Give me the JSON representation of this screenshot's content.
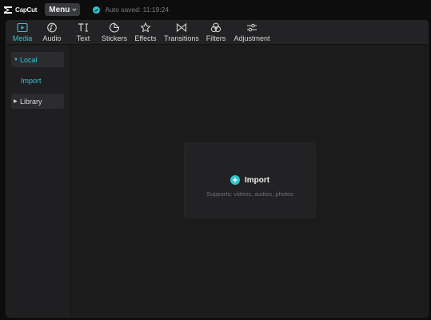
{
  "app": {
    "logo_text": "CapCut",
    "menu_label": "Menu",
    "save_status": "Auto saved: 11:19:24"
  },
  "toolbar": {
    "active": "Media",
    "items": [
      {
        "label": "Media",
        "icon": "media-icon"
      },
      {
        "label": "Audio",
        "icon": "audio-icon"
      },
      {
        "label": "Text",
        "icon": "text-icon"
      },
      {
        "label": "Stickers",
        "icon": "stickers-icon"
      },
      {
        "label": "Effects",
        "icon": "effects-icon"
      },
      {
        "label": "Transitions",
        "icon": "transitions-icon"
      },
      {
        "label": "Filters",
        "icon": "filters-icon"
      },
      {
        "label": "Adjustment",
        "icon": "adjustment-icon"
      }
    ]
  },
  "sidebar": {
    "local_label": "Local",
    "import_label": "Import",
    "library_label": "Library"
  },
  "import_area": {
    "label": "Import",
    "hint": "Supports: videos, audios, photos"
  },
  "colors": {
    "accent": "#2fc5cf",
    "background": "#1b1b1c",
    "toolbar": "#232325"
  }
}
